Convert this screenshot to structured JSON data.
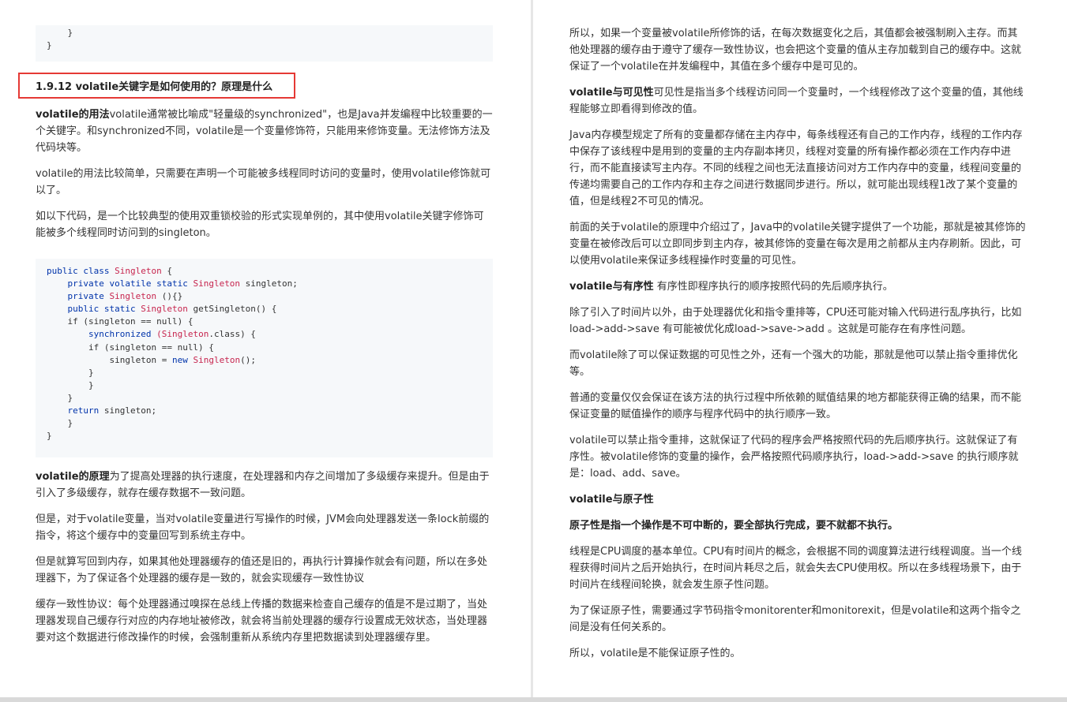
{
  "left": {
    "code_top": [
      "    }",
      "}"
    ],
    "heading": "1.9.12 volatile关键字是如何使用的？原理是什么",
    "p1_bold": "volatile的用法",
    "p1_rest": "volatile通常被比喻成\"轻量级的synchronized\"，也是Java并发编程中比较重要的一个关键字。和synchronized不同，volatile是一个变量修饰符，只能用来修饰变量。无法修饰方法及代码块等。",
    "p2": "volatile的用法比较简单，只需要在声明一个可能被多线程同时访问的变量时，使用volatile修饰就可以了。",
    "p3": "如以下代码，是一个比较典型的使用双重锁校验的形式实现单例的，其中使用volatile关键字修饰可能被多个线程同时访问到的singleton。",
    "code": {
      "l1_kw": "public class",
      "l1_ty": "Singleton",
      "l1_end": " {",
      "l2_kw": "private volatile static",
      "l2_ty": "Singleton",
      "l2_end": " singleton;",
      "l3_kw": "private",
      "l3_ty": "Singleton",
      "l3_end": " (){}",
      "l4_kw": "public static",
      "l4_ty": "Singleton",
      "l4_end": " getSingleton() {",
      "l5": "if (singleton == null) {",
      "l6_kw": "synchronized",
      "l6_ty": "(Singleton",
      "l6_end": ".class) {",
      "l7": "if (singleton == null) {",
      "l8_a": "singleton = ",
      "l8_kw": "new",
      "l8_ty": "Singleton",
      "l8_end": "();",
      "l9": "}",
      "l10": "}",
      "l11": "}",
      "l12_kw": "return",
      "l12_end": " singleton;",
      "l13": "}",
      "l14": "}"
    },
    "p4_bold": "volatile的原理",
    "p4_rest": "为了提高处理器的执行速度，在处理器和内存之间增加了多级缓存来提升。但是由于引入了多级缓存，就存在缓存数据不一致问题。",
    "p5": "但是，对于volatile变量，当对volatile变量进行写操作的时候，JVM会向处理器发送一条lock前缀的指令，将这个缓存中的变量回写到系统主存中。",
    "p6": "但是就算写回到内存，如果其他处理器缓存的值还是旧的，再执行计算操作就会有问题，所以在多处理器下，为了保证各个处理器的缓存是一致的，就会实现缓存一致性协议",
    "p7": "缓存一致性协议：每个处理器通过嗅探在总线上传播的数据来检查自己缓存的值是不是过期了，当处理器发现自己缓存行对应的内存地址被修改，就会将当前处理器的缓存行设置成无效状态，当处理器要对这个数据进行修改操作的时候，会强制重新从系统内存里把数据读到处理器缓存里。"
  },
  "right": {
    "p1": "所以，如果一个变量被volatile所修饰的话，在每次数据变化之后，其值都会被强制刷入主存。而其他处理器的缓存由于遵守了缓存一致性协议，也会把这个变量的值从主存加载到自己的缓存中。这就保证了一个volatile在并发编程中，其值在多个缓存中是可见的。",
    "p2_bold": "volatile与可见性",
    "p2_rest": "可见性是指当多个线程访问同一个变量时，一个线程修改了这个变量的值，其他线程能够立即看得到修改的值。",
    "p3": "Java内存模型规定了所有的变量都存储在主内存中，每条线程还有自己的工作内存，线程的工作内存中保存了该线程中是用到的变量的主内存副本拷贝，线程对变量的所有操作都必须在工作内存中进行，而不能直接读写主内存。不同的线程之间也无法直接访问对方工作内存中的变量，线程间变量的传递均需要自己的工作内存和主存之间进行数据同步进行。所以，就可能出现线程1改了某个变量的值，但是线程2不可见的情况。",
    "p4": "前面的关于volatile的原理中介绍过了，Java中的volatile关键字提供了一个功能，那就是被其修饰的变量在被修改后可以立即同步到主内存，被其修饰的变量在每次是用之前都从主内存刷新。因此，可以使用volatile来保证多线程操作时变量的可见性。",
    "p5_bold": "volatile与有序性",
    "p5_rest": " 有序性即程序执行的顺序按照代码的先后顺序执行。",
    "p6": "除了引入了时间片以外，由于处理器优化和指令重排等，CPU还可能对输入代码进行乱序执行，比如load->add->save 有可能被优化成load->save->add 。这就是可能存在有序性问题。",
    "p7": "而volatile除了可以保证数据的可见性之外，还有一个强大的功能，那就是他可以禁止指令重排优化等。",
    "p8": "普通的变量仅仅会保证在该方法的执行过程中所依赖的赋值结果的地方都能获得正确的结果，而不能保证变量的赋值操作的顺序与程序代码中的执行顺序一致。",
    "p9": "volatile可以禁止指令重排，这就保证了代码的程序会严格按照代码的先后顺序执行。这就保证了有序性。被volatile修饰的变量的操作，会严格按照代码顺序执行，load->add->save 的执行顺序就是：load、add、save。",
    "p10": "volatile与原子性",
    "p11": "原子性是指一个操作是不可中断的，要全部执行完成，要不就都不执行。",
    "p12": "线程是CPU调度的基本单位。CPU有时间片的概念，会根据不同的调度算法进行线程调度。当一个线程获得时间片之后开始执行，在时间片耗尽之后，就会失去CPU使用权。所以在多线程场景下，由于时间片在线程间轮换，就会发生原子性问题。",
    "p13": "为了保证原子性，需要通过字节码指令monitorenter和monitorexit，但是volatile和这两个指令之间是没有任何关系的。",
    "p14": "所以，volatile是不能保证原子性的。"
  }
}
